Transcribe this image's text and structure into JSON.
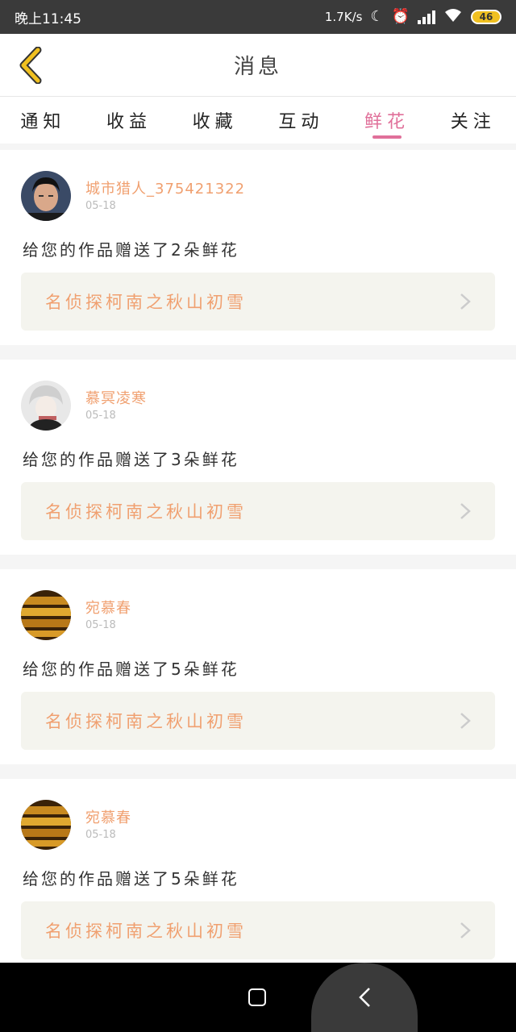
{
  "status_bar": {
    "time": "晚上11:45",
    "net_speed": "1.7K/s",
    "battery": "46",
    "icons": [
      "moon-icon",
      "alarm-icon",
      "signal-icon",
      "wifi-icon",
      "battery-icon"
    ]
  },
  "header": {
    "title": "消息",
    "back_icon": "chevron-left-icon",
    "accent_color": "#f0c020"
  },
  "tabs": [
    {
      "label": "通知",
      "active": false
    },
    {
      "label": "收益",
      "active": false
    },
    {
      "label": "收藏",
      "active": false
    },
    {
      "label": "互动",
      "active": false
    },
    {
      "label": "鲜花",
      "active": true
    },
    {
      "label": "关注",
      "active": false
    }
  ],
  "active_tab_color": "#e0709a",
  "messages": [
    {
      "user": "城市猎人_375421322",
      "date": "05-18",
      "text": "给您的作品赠送了2朵鲜花",
      "work": "名侦探柯南之秋山初雪",
      "avatar": "photo-person-avatar"
    },
    {
      "user": "慕冥凌寒",
      "date": "05-18",
      "text": "给您的作品赠送了3朵鲜花",
      "work": "名侦探柯南之秋山初雪",
      "avatar": "anime-character-avatar"
    },
    {
      "user": "宛慕春",
      "date": "05-18",
      "text": "给您的作品赠送了5朵鲜花",
      "work": "名侦探柯南之秋山初雪",
      "avatar": "gold-bars-avatar"
    },
    {
      "user": "宛慕春",
      "date": "05-18",
      "text": "给您的作品赠送了5朵鲜花",
      "work": "名侦探柯南之秋山初雪",
      "avatar": "gold-bars-avatar"
    }
  ],
  "name_color": "#f0a070",
  "nav_bar": {
    "icons": [
      "home-square-icon",
      "back-arrow-icon"
    ]
  }
}
